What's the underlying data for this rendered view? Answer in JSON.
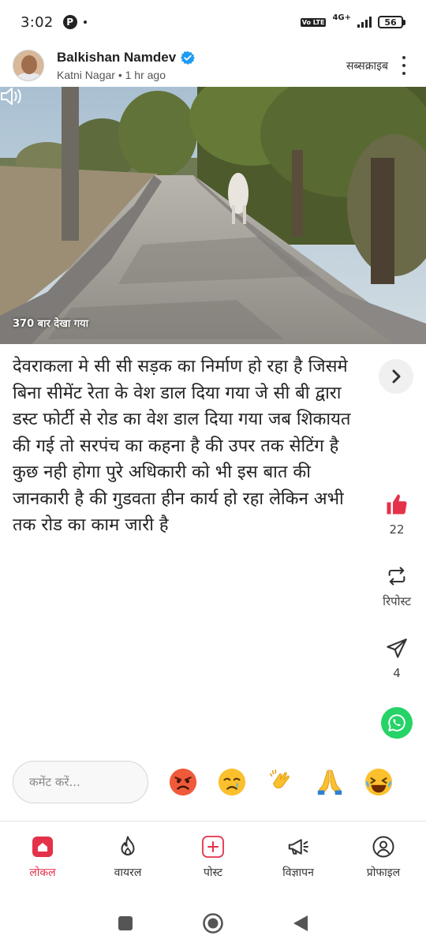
{
  "status_bar": {
    "time": "3:02",
    "notification_badge": "P",
    "volte": "Vo LTE",
    "network": "4G+",
    "battery": "56"
  },
  "post": {
    "author_name": "Balkishan Namdev",
    "location": "Katni Nagar",
    "time_ago": "1 hr ago",
    "subscribe_label": "सब्सक्राइब",
    "views": "370 बार देखा गया",
    "text": "देवराकला मे सी सी सड़क का निर्माण हो रहा है जिसमे बिना सीमेंट रेता के वेश डाल दिया गया जे सी बी द्वारा  डस्ट फोर्टी से रोड का वेश डाल दिया गया जब शिकायत की गई तो सरपंच का कहना है की उपर तक सेटिंग है कुछ नही होगा पुरे अधिकारी को भी इस बात की जानकारी है की गुडवता हीन कार्य हो रहा लेकिन अभी तक रोड का काम जारी है"
  },
  "actions": {
    "like_count": "22",
    "repost_label": "रिपोस्ट",
    "share_count": "4"
  },
  "comment": {
    "placeholder": "कमेंट करें..."
  },
  "nav": {
    "items": [
      {
        "label": "लोकल",
        "icon": "home-icon",
        "active": true
      },
      {
        "label": "वायरल",
        "icon": "fire-icon"
      },
      {
        "label": "पोस्ट",
        "icon": "add-post-icon"
      },
      {
        "label": "विज्ञापन",
        "icon": "megaphone-icon"
      },
      {
        "label": "प्रोफाइल",
        "icon": "profile-icon"
      }
    ]
  },
  "colors": {
    "accent": "#e4324a",
    "verified": "#1d9bf0",
    "whatsapp": "#25d366"
  }
}
